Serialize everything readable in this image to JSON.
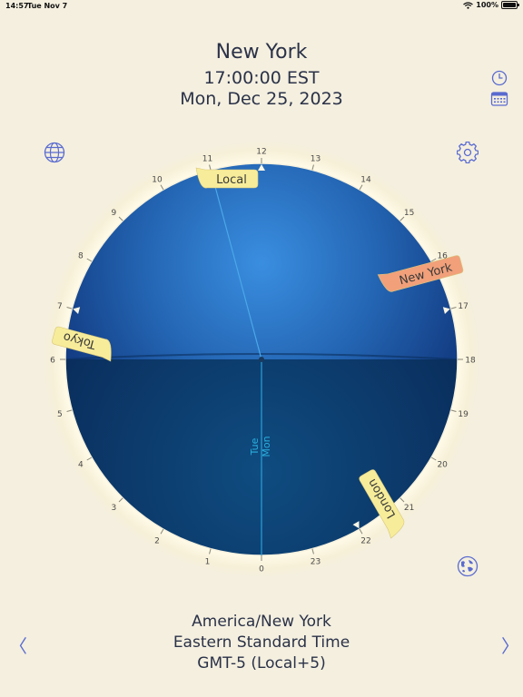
{
  "status_bar": {
    "time": "14:57",
    "date": "Tue Nov 7",
    "battery_text": "100%",
    "battery_level": 1.0
  },
  "header": {
    "city": "New York",
    "time": "17:00:00 EST",
    "date": "Mon, Dec 25, 2023"
  },
  "dial": {
    "hour_labels": [
      "0",
      "1",
      "2",
      "3",
      "4",
      "5",
      "6",
      "7",
      "8",
      "9",
      "10",
      "11",
      "12",
      "13",
      "14",
      "15",
      "16",
      "17",
      "18",
      "19",
      "20",
      "21",
      "22",
      "23"
    ],
    "markers": [
      {
        "label": "Local",
        "hour": 12,
        "color": "#f7ec9a"
      },
      {
        "label": "New York",
        "hour": 17,
        "color": "#f1a07a"
      },
      {
        "label": "Tokyo",
        "hour": 7,
        "color": "#f7ec9a"
      },
      {
        "label": "London",
        "hour": 22,
        "color": "#f7ec9a"
      }
    ],
    "hand_hour": 11,
    "day_labels": {
      "next": "Tue",
      "current": "Mon"
    }
  },
  "footer": {
    "zone": "America/New York",
    "name": "Eastern Standard Time",
    "offset": "GMT-5 (Local+5)"
  },
  "nav": {
    "prev": "〈",
    "next": "〉"
  },
  "colors": {
    "background": "#f4efdf",
    "accent": "#5a6bd0",
    "day": "#2c78c8",
    "night": "#0e4474"
  }
}
